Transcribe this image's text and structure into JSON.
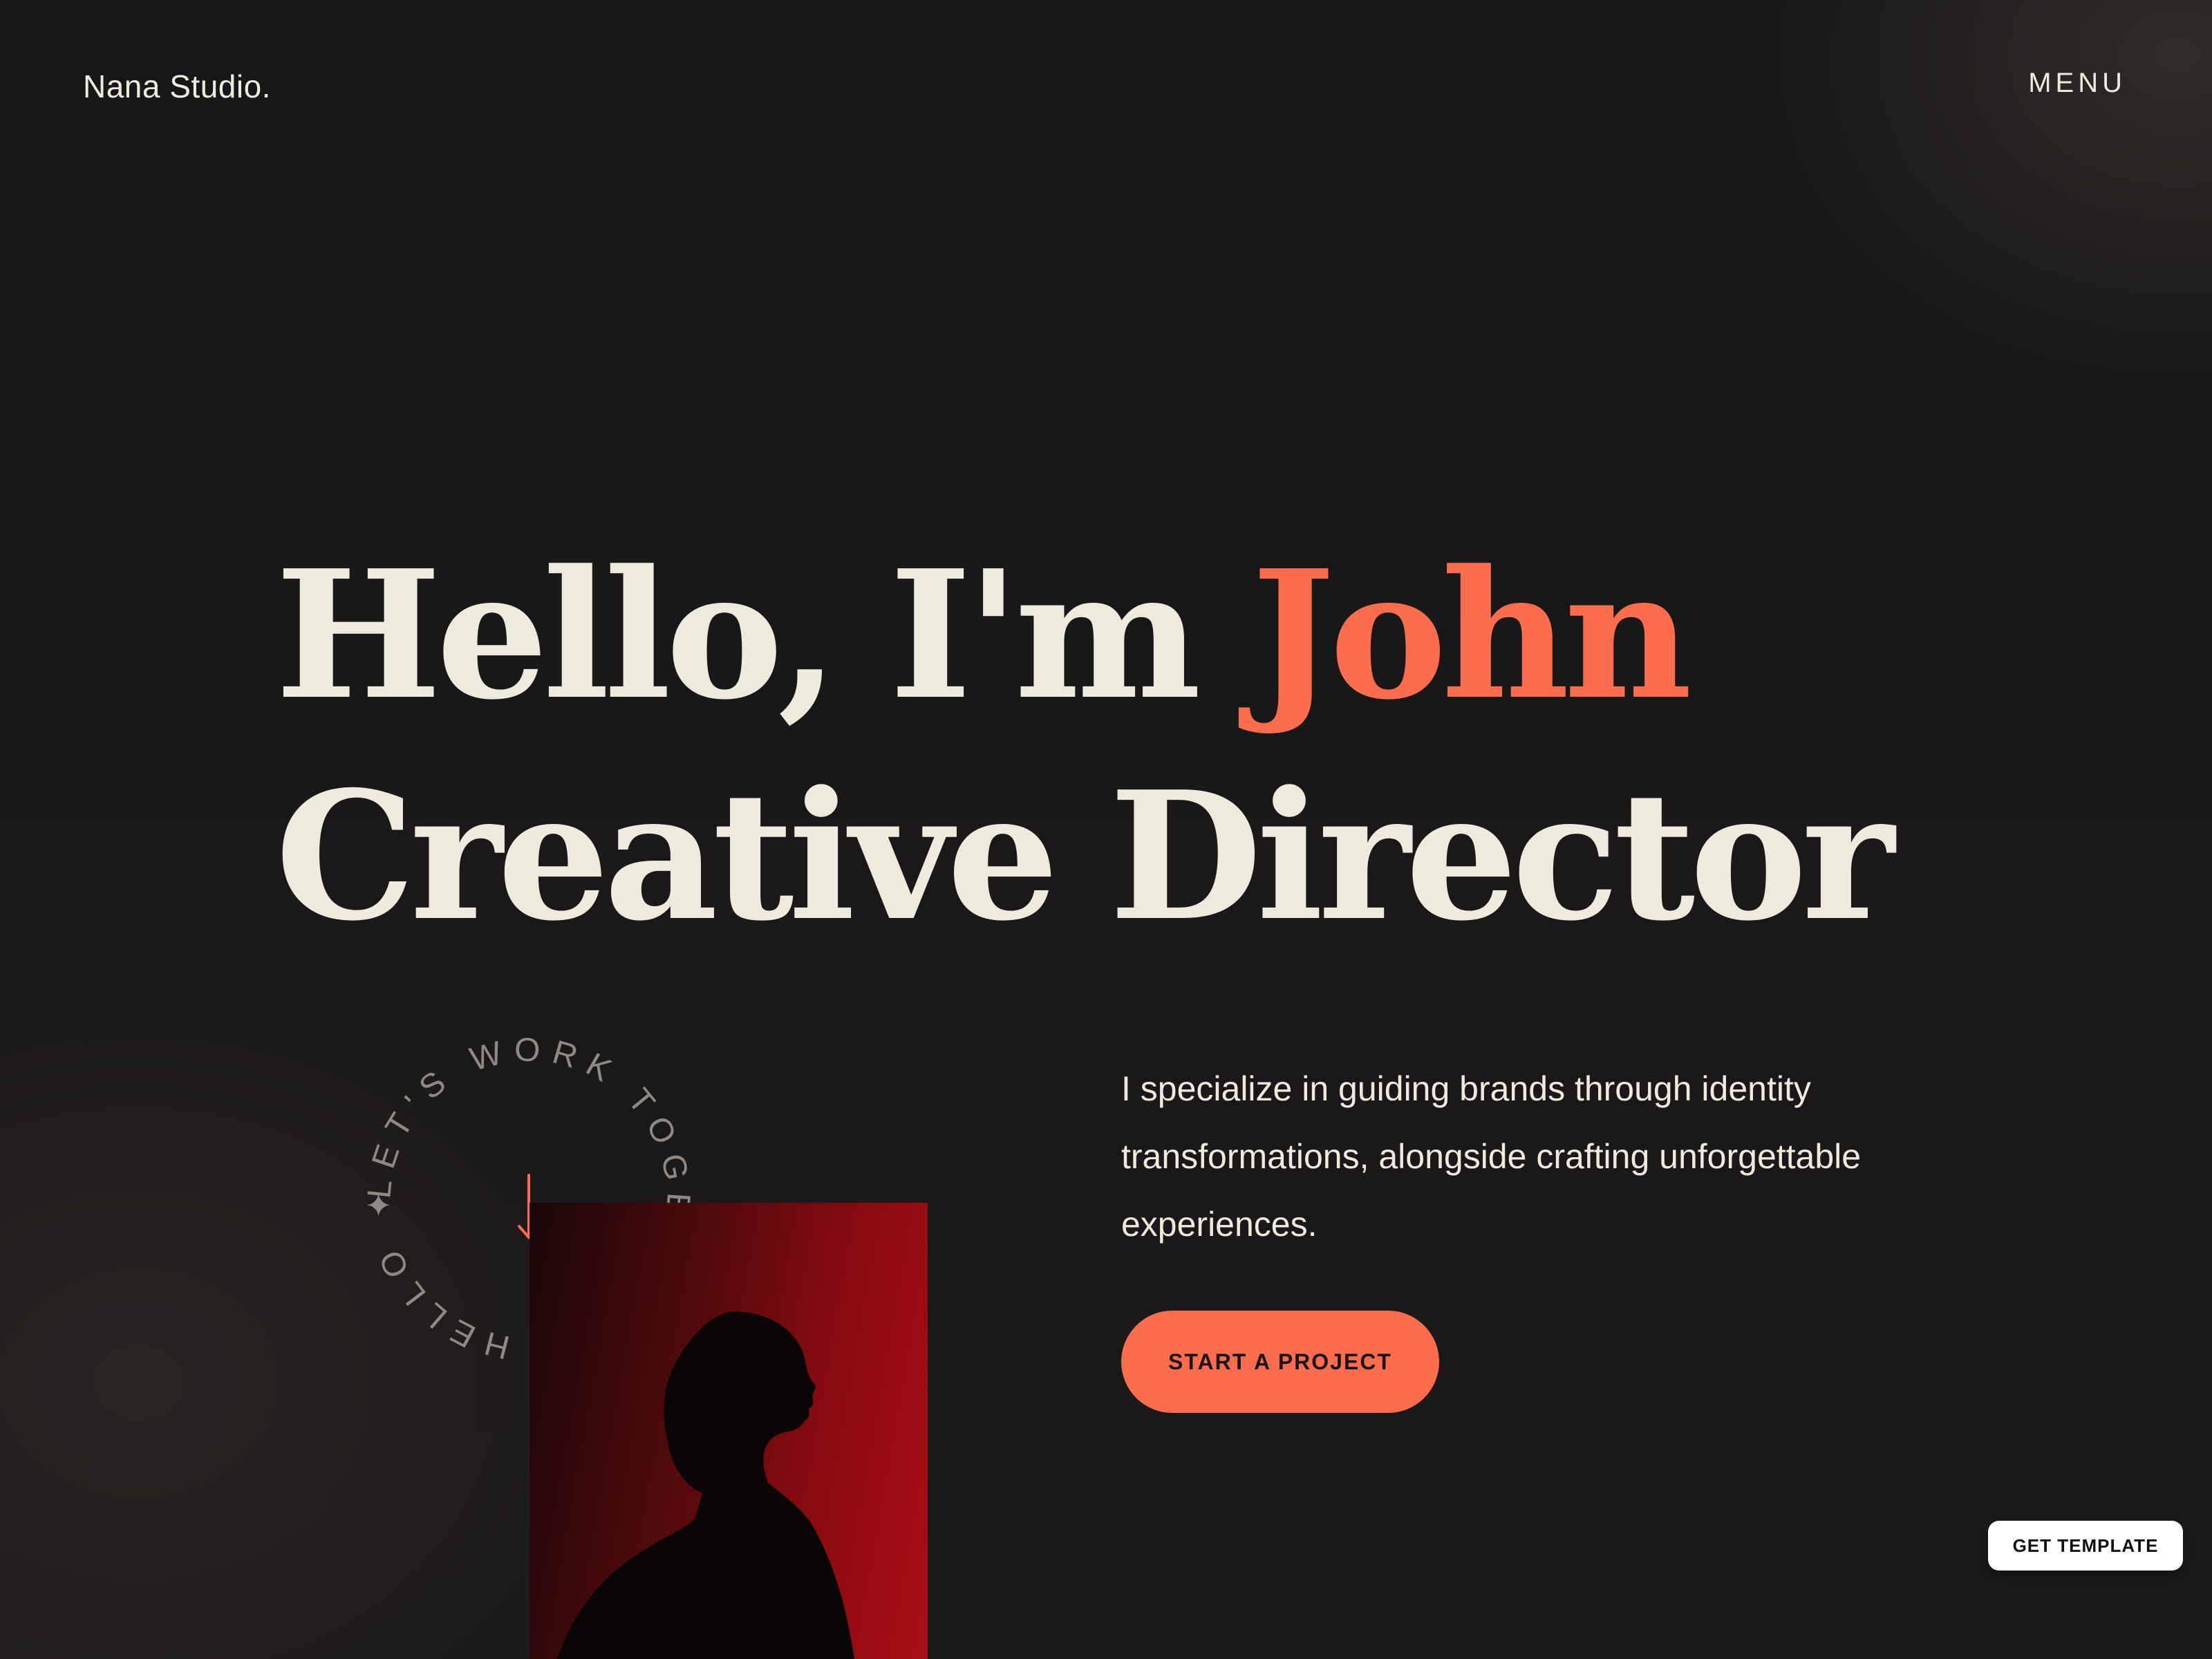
{
  "header": {
    "brand": "Nana Studio.",
    "menu_label": "MENU"
  },
  "hero": {
    "greeting": "Hello, I'm ",
    "name": "John",
    "role": "Creative Director",
    "intro": "I specialize in guiding brands through identity transformations, alongside crafting unforgettable experiences.",
    "cta_label": "START A PROJECT"
  },
  "badge": {
    "circular_text": "LET'S WORK TOGETHER ✦ HELLO ✦",
    "icon": "arrow-down-icon"
  },
  "floating": {
    "get_template_label": "GET TEMPLATE"
  },
  "colors": {
    "background": "#161616",
    "text": "#efebdc",
    "accent": "#fb6d4d",
    "photo_red": "#a80f16"
  }
}
